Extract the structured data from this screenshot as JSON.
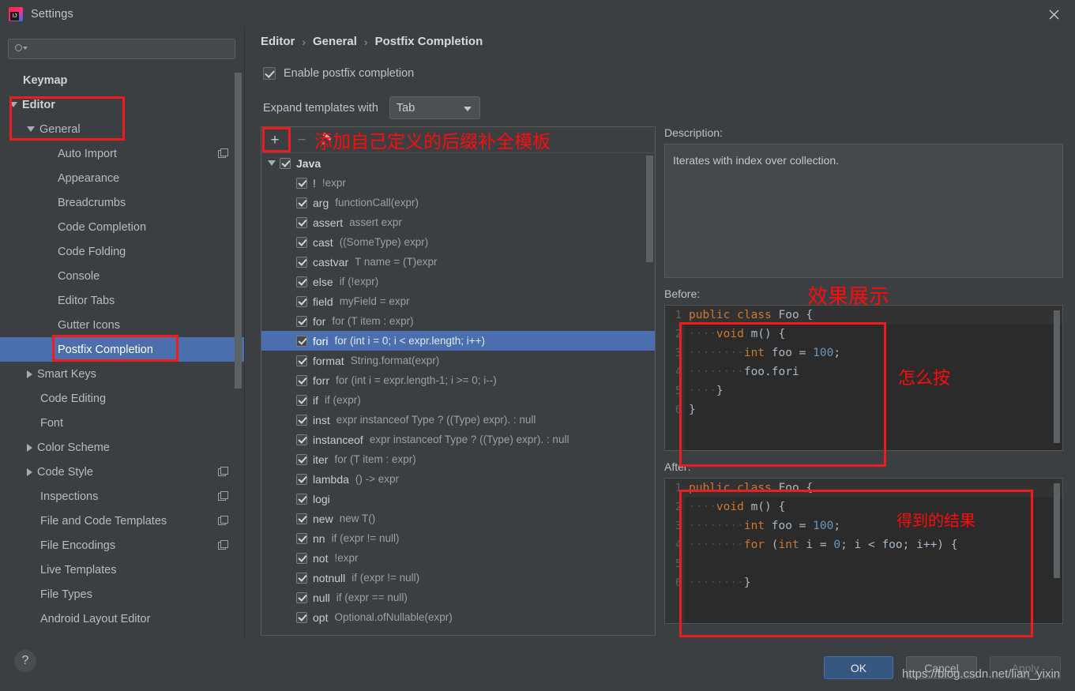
{
  "window": {
    "title": "Settings",
    "logo_icon": "intellij-idea-logo",
    "close_icon": "close-icon"
  },
  "sidebar": {
    "search": {
      "placeholder": "",
      "value": "",
      "icon": "search-icon"
    },
    "items": [
      {
        "label": "Keymap",
        "indent": 0,
        "twisty": "none",
        "bold": true,
        "badge": false,
        "selected": false
      },
      {
        "label": "Editor",
        "indent": 0,
        "twisty": "down",
        "bold": true,
        "badge": false,
        "selected": false
      },
      {
        "label": "General",
        "indent": 1,
        "twisty": "down",
        "bold": false,
        "badge": false,
        "selected": false
      },
      {
        "label": "Auto Import",
        "indent": 2,
        "twisty": "none",
        "bold": false,
        "badge": true,
        "selected": false
      },
      {
        "label": "Appearance",
        "indent": 2,
        "twisty": "none",
        "bold": false,
        "badge": false,
        "selected": false
      },
      {
        "label": "Breadcrumbs",
        "indent": 2,
        "twisty": "none",
        "bold": false,
        "badge": false,
        "selected": false
      },
      {
        "label": "Code Completion",
        "indent": 2,
        "twisty": "none",
        "bold": false,
        "badge": false,
        "selected": false
      },
      {
        "label": "Code Folding",
        "indent": 2,
        "twisty": "none",
        "bold": false,
        "badge": false,
        "selected": false
      },
      {
        "label": "Console",
        "indent": 2,
        "twisty": "none",
        "bold": false,
        "badge": false,
        "selected": false
      },
      {
        "label": "Editor Tabs",
        "indent": 2,
        "twisty": "none",
        "bold": false,
        "badge": false,
        "selected": false
      },
      {
        "label": "Gutter Icons",
        "indent": 2,
        "twisty": "none",
        "bold": false,
        "badge": false,
        "selected": false
      },
      {
        "label": "Postfix Completion",
        "indent": 2,
        "twisty": "none",
        "bold": false,
        "badge": false,
        "selected": true
      },
      {
        "label": "Smart Keys",
        "indent": 1,
        "twisty": "right",
        "bold": false,
        "badge": false,
        "selected": false
      },
      {
        "label": "Code Editing",
        "indent": 1,
        "twisty": "none",
        "bold": false,
        "badge": false,
        "selected": false
      },
      {
        "label": "Font",
        "indent": 1,
        "twisty": "none",
        "bold": false,
        "badge": false,
        "selected": false
      },
      {
        "label": "Color Scheme",
        "indent": 1,
        "twisty": "right",
        "bold": false,
        "badge": false,
        "selected": false
      },
      {
        "label": "Code Style",
        "indent": 1,
        "twisty": "right",
        "bold": false,
        "badge": true,
        "selected": false
      },
      {
        "label": "Inspections",
        "indent": 1,
        "twisty": "none",
        "bold": false,
        "badge": true,
        "selected": false
      },
      {
        "label": "File and Code Templates",
        "indent": 1,
        "twisty": "none",
        "bold": false,
        "badge": true,
        "selected": false
      },
      {
        "label": "File Encodings",
        "indent": 1,
        "twisty": "none",
        "bold": false,
        "badge": true,
        "selected": false
      },
      {
        "label": "Live Templates",
        "indent": 1,
        "twisty": "none",
        "bold": false,
        "badge": false,
        "selected": false
      },
      {
        "label": "File Types",
        "indent": 1,
        "twisty": "none",
        "bold": false,
        "badge": false,
        "selected": false
      },
      {
        "label": "Android Layout Editor",
        "indent": 1,
        "twisty": "none",
        "bold": false,
        "badge": false,
        "selected": false
      }
    ]
  },
  "main": {
    "breadcrumb": [
      "Editor",
      "General",
      "Postfix Completion"
    ],
    "breadcrumb_sep": "›",
    "enable_checkbox": {
      "label": "Enable postfix completion",
      "checked": true
    },
    "expand_with": {
      "label": "Expand templates with",
      "value": "Tab"
    },
    "toolbar": {
      "add_label": "+",
      "remove_label": "−",
      "edit_icon": "pencil-icon"
    },
    "templates": [
      {
        "name": "Java",
        "desc": "",
        "group": true
      },
      {
        "name": "!",
        "desc": "!expr",
        "group": false
      },
      {
        "name": "arg",
        "desc": "functionCall(expr)",
        "group": false
      },
      {
        "name": "assert",
        "desc": "assert expr",
        "group": false
      },
      {
        "name": "cast",
        "desc": "((SomeType) expr)",
        "group": false
      },
      {
        "name": "castvar",
        "desc": "T name = (T)expr",
        "group": false
      },
      {
        "name": "else",
        "desc": "if (!expr)",
        "group": false
      },
      {
        "name": "field",
        "desc": "myField = expr",
        "group": false
      },
      {
        "name": "for",
        "desc": "for (T item : expr)",
        "group": false
      },
      {
        "name": "fori",
        "desc": "for (int i = 0; i < expr.length; i++)",
        "group": false,
        "selected": true
      },
      {
        "name": "format",
        "desc": "String.format(expr)",
        "group": false
      },
      {
        "name": "forr",
        "desc": "for (int i = expr.length-1; i >= 0; i--)",
        "group": false
      },
      {
        "name": "if",
        "desc": "if (expr)",
        "group": false
      },
      {
        "name": "inst",
        "desc": "expr instanceof Type ? ((Type) expr). : null",
        "group": false
      },
      {
        "name": "instanceof",
        "desc": "expr instanceof Type ? ((Type) expr). : null",
        "group": false
      },
      {
        "name": "iter",
        "desc": "for (T item : expr)",
        "group": false
      },
      {
        "name": "lambda",
        "desc": "() -> expr",
        "group": false
      },
      {
        "name": "logi",
        "desc": "",
        "group": false
      },
      {
        "name": "new",
        "desc": "new T()",
        "group": false
      },
      {
        "name": "nn",
        "desc": "if (expr != null)",
        "group": false
      },
      {
        "name": "not",
        "desc": "!expr",
        "group": false
      },
      {
        "name": "notnull",
        "desc": "if (expr != null)",
        "group": false
      },
      {
        "name": "null",
        "desc": "if (expr == null)",
        "group": false
      },
      {
        "name": "opt",
        "desc": "Optional.ofNullable(expr)",
        "group": false
      }
    ],
    "description": {
      "label": "Description:",
      "text": "Iterates with index over collection."
    },
    "before": {
      "label": "Before:",
      "lines": [
        {
          "n": "1",
          "tokens": [
            {
              "t": "public class ",
              "c": "kw"
            },
            {
              "t": "Foo ",
              "c": "pl"
            },
            {
              "t": "{",
              "c": "pl"
            }
          ]
        },
        {
          "n": "2",
          "tokens": [
            {
              "t": "····",
              "c": "dot"
            },
            {
              "t": "void ",
              "c": "kw"
            },
            {
              "t": "m() {",
              "c": "pl"
            }
          ]
        },
        {
          "n": "3",
          "tokens": [
            {
              "t": "········",
              "c": "dot"
            },
            {
              "t": "int ",
              "c": "kw"
            },
            {
              "t": "foo = ",
              "c": "pl"
            },
            {
              "t": "100",
              "c": "num"
            },
            {
              "t": ";",
              "c": "pl"
            }
          ]
        },
        {
          "n": "4",
          "tokens": [
            {
              "t": "········",
              "c": "dot"
            },
            {
              "t": "foo.fori",
              "c": "pl"
            }
          ]
        },
        {
          "n": "5",
          "tokens": [
            {
              "t": "····",
              "c": "dot"
            },
            {
              "t": "}",
              "c": "pl"
            }
          ]
        },
        {
          "n": "6",
          "tokens": [
            {
              "t": "}",
              "c": "pl"
            }
          ]
        }
      ]
    },
    "after": {
      "label": "After:",
      "lines": [
        {
          "n": "1",
          "tokens": [
            {
              "t": "public class ",
              "c": "kw"
            },
            {
              "t": "Foo ",
              "c": "pl"
            },
            {
              "t": "{",
              "c": "pl"
            }
          ]
        },
        {
          "n": "2",
          "tokens": [
            {
              "t": "····",
              "c": "dot"
            },
            {
              "t": "void ",
              "c": "kw"
            },
            {
              "t": "m() {",
              "c": "pl"
            }
          ]
        },
        {
          "n": "3",
          "tokens": [
            {
              "t": "········",
              "c": "dot"
            },
            {
              "t": "int ",
              "c": "kw"
            },
            {
              "t": "foo = ",
              "c": "pl"
            },
            {
              "t": "100",
              "c": "num"
            },
            {
              "t": ";",
              "c": "pl"
            }
          ]
        },
        {
          "n": "4",
          "tokens": [
            {
              "t": "········",
              "c": "dot"
            },
            {
              "t": "for ",
              "c": "kw"
            },
            {
              "t": "(",
              "c": "pl"
            },
            {
              "t": "int ",
              "c": "kw"
            },
            {
              "t": "i = ",
              "c": "pl"
            },
            {
              "t": "0",
              "c": "num"
            },
            {
              "t": "; i < foo; i++) {",
              "c": "pl"
            }
          ]
        },
        {
          "n": "5",
          "tokens": [
            {
              "t": "",
              "c": "pl"
            }
          ]
        },
        {
          "n": "6",
          "tokens": [
            {
              "t": "········",
              "c": "dot"
            },
            {
              "t": "}",
              "c": "pl"
            }
          ]
        }
      ]
    }
  },
  "annotations": {
    "add_template_note": "添加自己定义的后缀补全模板",
    "effect_demo": "效果展示",
    "how_to_press": "怎么按",
    "result_obtained": "得到的结果",
    "box_color": "#ee1c1c"
  },
  "footer": {
    "help_label": "?",
    "ok_label": "OK",
    "cancel_label": "Cancel",
    "apply_label": "Apply",
    "watermark": "https://blog.csdn.net/lian_yixin"
  }
}
